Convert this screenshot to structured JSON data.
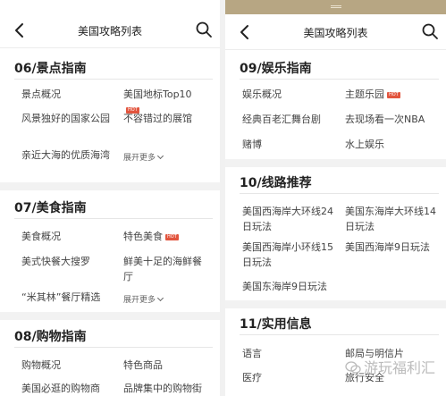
{
  "left": {
    "header": {
      "title": "美国攻略列表"
    },
    "sections": [
      {
        "title": "06/景点指南",
        "items": [
          "景点概况",
          "美国地标Top10",
          "风景独好的国家公园",
          "不容错过的展馆",
          "亲近大海的优质海湾"
        ],
        "more": "展开更多"
      },
      {
        "title": "07/美食指南",
        "items": [
          "美食概况",
          "特色美食",
          "美式快餐大搜罗",
          "鲜美十足的海鲜餐厅",
          "“米其林”餐厅精选"
        ],
        "more": "展开更多"
      },
      {
        "title": "08/购物指南",
        "items": [
          "购物概况",
          "特色商品",
          "美国必逛的购物商",
          "品牌集中的购物街"
        ]
      }
    ],
    "hot_badge": "HOT"
  },
  "right": {
    "header": {
      "title": "美国攻略列表"
    },
    "sections": [
      {
        "title": "09/娱乐指南",
        "items": [
          "娱乐概况",
          "主题乐园",
          "经典百老汇舞台剧",
          "去现场看一次NBA",
          "赌博",
          "水上娱乐"
        ]
      },
      {
        "title": "10/线路推荐",
        "items": [
          "美国西海岸大环线24日玩法",
          "美国东海岸大环线14日玩法",
          "美国西海岸小环线15日玩法",
          "美国西海岸9日玩法",
          "美国东海岸9日玩法"
        ]
      },
      {
        "title": "11/实用信息",
        "items": [
          "语言",
          "邮局与明信片",
          "医疗",
          "旅行安全"
        ]
      }
    ],
    "hot_badge": "HOT"
  },
  "watermark": "游玩福利汇",
  "colors": {
    "hot": "#e2553e",
    "strip": "#b7a683",
    "gap": "#f2f2f2"
  },
  "icons": [
    "back-arrow-icon",
    "search-icon",
    "chevron-down-icon",
    "wechat-icon"
  ]
}
